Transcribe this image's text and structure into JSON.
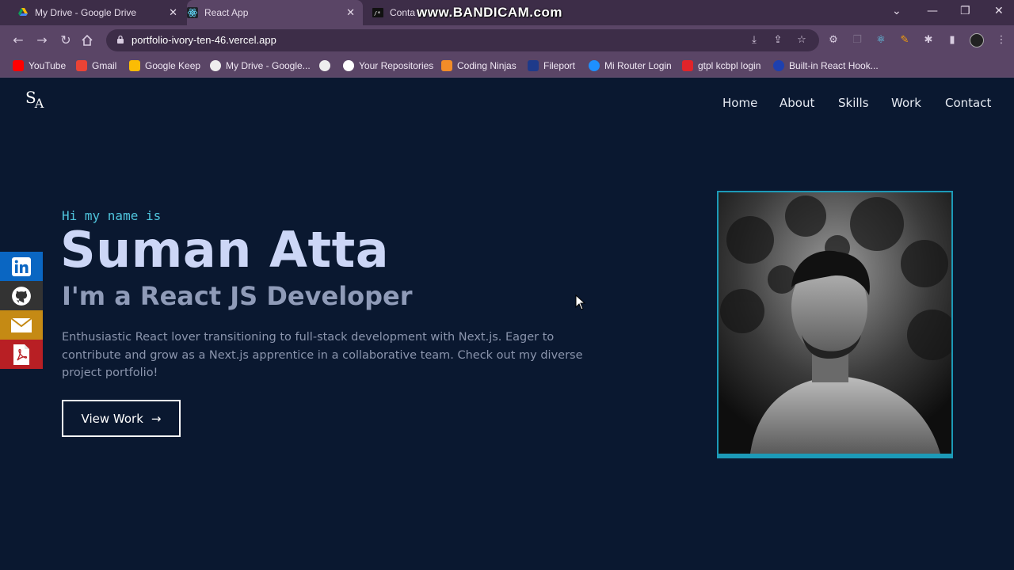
{
  "browser": {
    "tabs": [
      {
        "title": "My Drive - Google Drive",
        "close": "✕"
      },
      {
        "title": "React App",
        "close": "✕"
      },
      {
        "title": "Conta"
      }
    ],
    "watermark": "www.BANDICAM.com",
    "window_controls": {
      "dropdown": "⌄",
      "minimize": "—",
      "restore": "❐",
      "close": "✕"
    },
    "url": "portfolio-ivory-ten-46.vercel.app",
    "bookmarks": [
      {
        "label": "YouTube",
        "color": "#ff0000"
      },
      {
        "label": "Gmail",
        "color": "#ea4335"
      },
      {
        "label": "Google Keep",
        "color": "#fbbc04"
      },
      {
        "label": "My Drive - Google...",
        "color": "#ffffff"
      },
      {
        "label": "",
        "color": "#ffffff"
      },
      {
        "label": "Your Repositories",
        "color": "#ffffff"
      },
      {
        "label": "Coding Ninjas",
        "color": "#f28c28"
      },
      {
        "label": "Fileport",
        "color": "#1e3a8a"
      },
      {
        "label": "Mi Router Login",
        "color": "#1e90ff"
      },
      {
        "label": "gtpl kcbpl login",
        "color": "#e0242a"
      },
      {
        "label": "Built-in React Hook...",
        "color": "#1e40af"
      }
    ]
  },
  "site": {
    "logo": {
      "s": "S",
      "a": "A"
    },
    "nav": [
      "Home",
      "About",
      "Skills",
      "Work",
      "Contact"
    ],
    "greeting": "Hi my name is",
    "name": "Suman Atta",
    "role": "I'm a React JS Developer",
    "bio": "Enthusiastic React lover transitioning to full-stack development with Next.js. Eager to contribute and grow as a Next.js apprentice in a collaborative team. Check out my diverse project portfolio!",
    "cta": "View Work",
    "cta_arrow": "→",
    "social": [
      {
        "name": "linkedin",
        "color": "#0a66c2"
      },
      {
        "name": "github",
        "color": "#333333"
      },
      {
        "name": "email",
        "color": "#c58a14"
      },
      {
        "name": "resume",
        "color": "#b81f24"
      }
    ],
    "accent": "#4fc4dc",
    "frame_color": "#1c9ab8"
  }
}
